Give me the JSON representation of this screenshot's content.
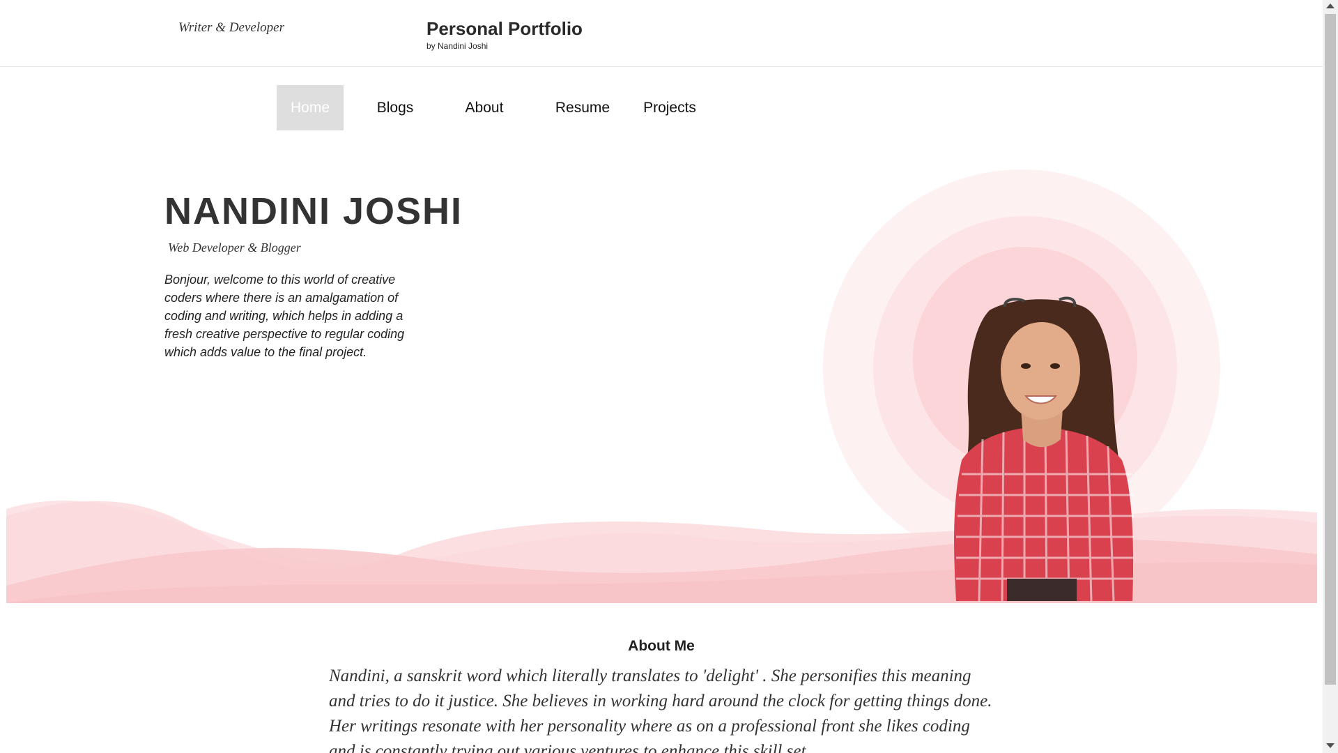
{
  "header": {
    "tagline": "Writer & Developer",
    "title": "Personal Portfolio",
    "byline": "by Nandini Joshi"
  },
  "nav": {
    "items": [
      {
        "label": "Home",
        "active": true
      },
      {
        "label": "Blogs",
        "active": false
      },
      {
        "label": "About",
        "active": false
      },
      {
        "label": "Resume",
        "active": false
      },
      {
        "label": "Projects",
        "active": false
      }
    ]
  },
  "hero": {
    "name": "NANDINI JOSHI",
    "role": "Web Developer & Blogger",
    "intro": "Bonjour, welcome to this world of creative coders where there is an amalgamation of coding and writing, which helps in adding a fresh creative perspective to regular coding which adds value to the final project.",
    "portrait_icon": "person-photo"
  },
  "about": {
    "heading": "About Me",
    "text": "Nandini, a sanskrit word which literally translates to 'delight' . She personifies this meaning and tries to do it justice. She believes in working hard around the clock for getting things done. Her writings resonate with her personality where as on a professional front she likes coding and is constantly trying out various ventures to enhance this skill set."
  },
  "colors": {
    "accent_pink": "#f8c9cc",
    "light_pink": "#fde8e9",
    "nav_active_bg": "#dedede",
    "text_dark": "#333333"
  }
}
